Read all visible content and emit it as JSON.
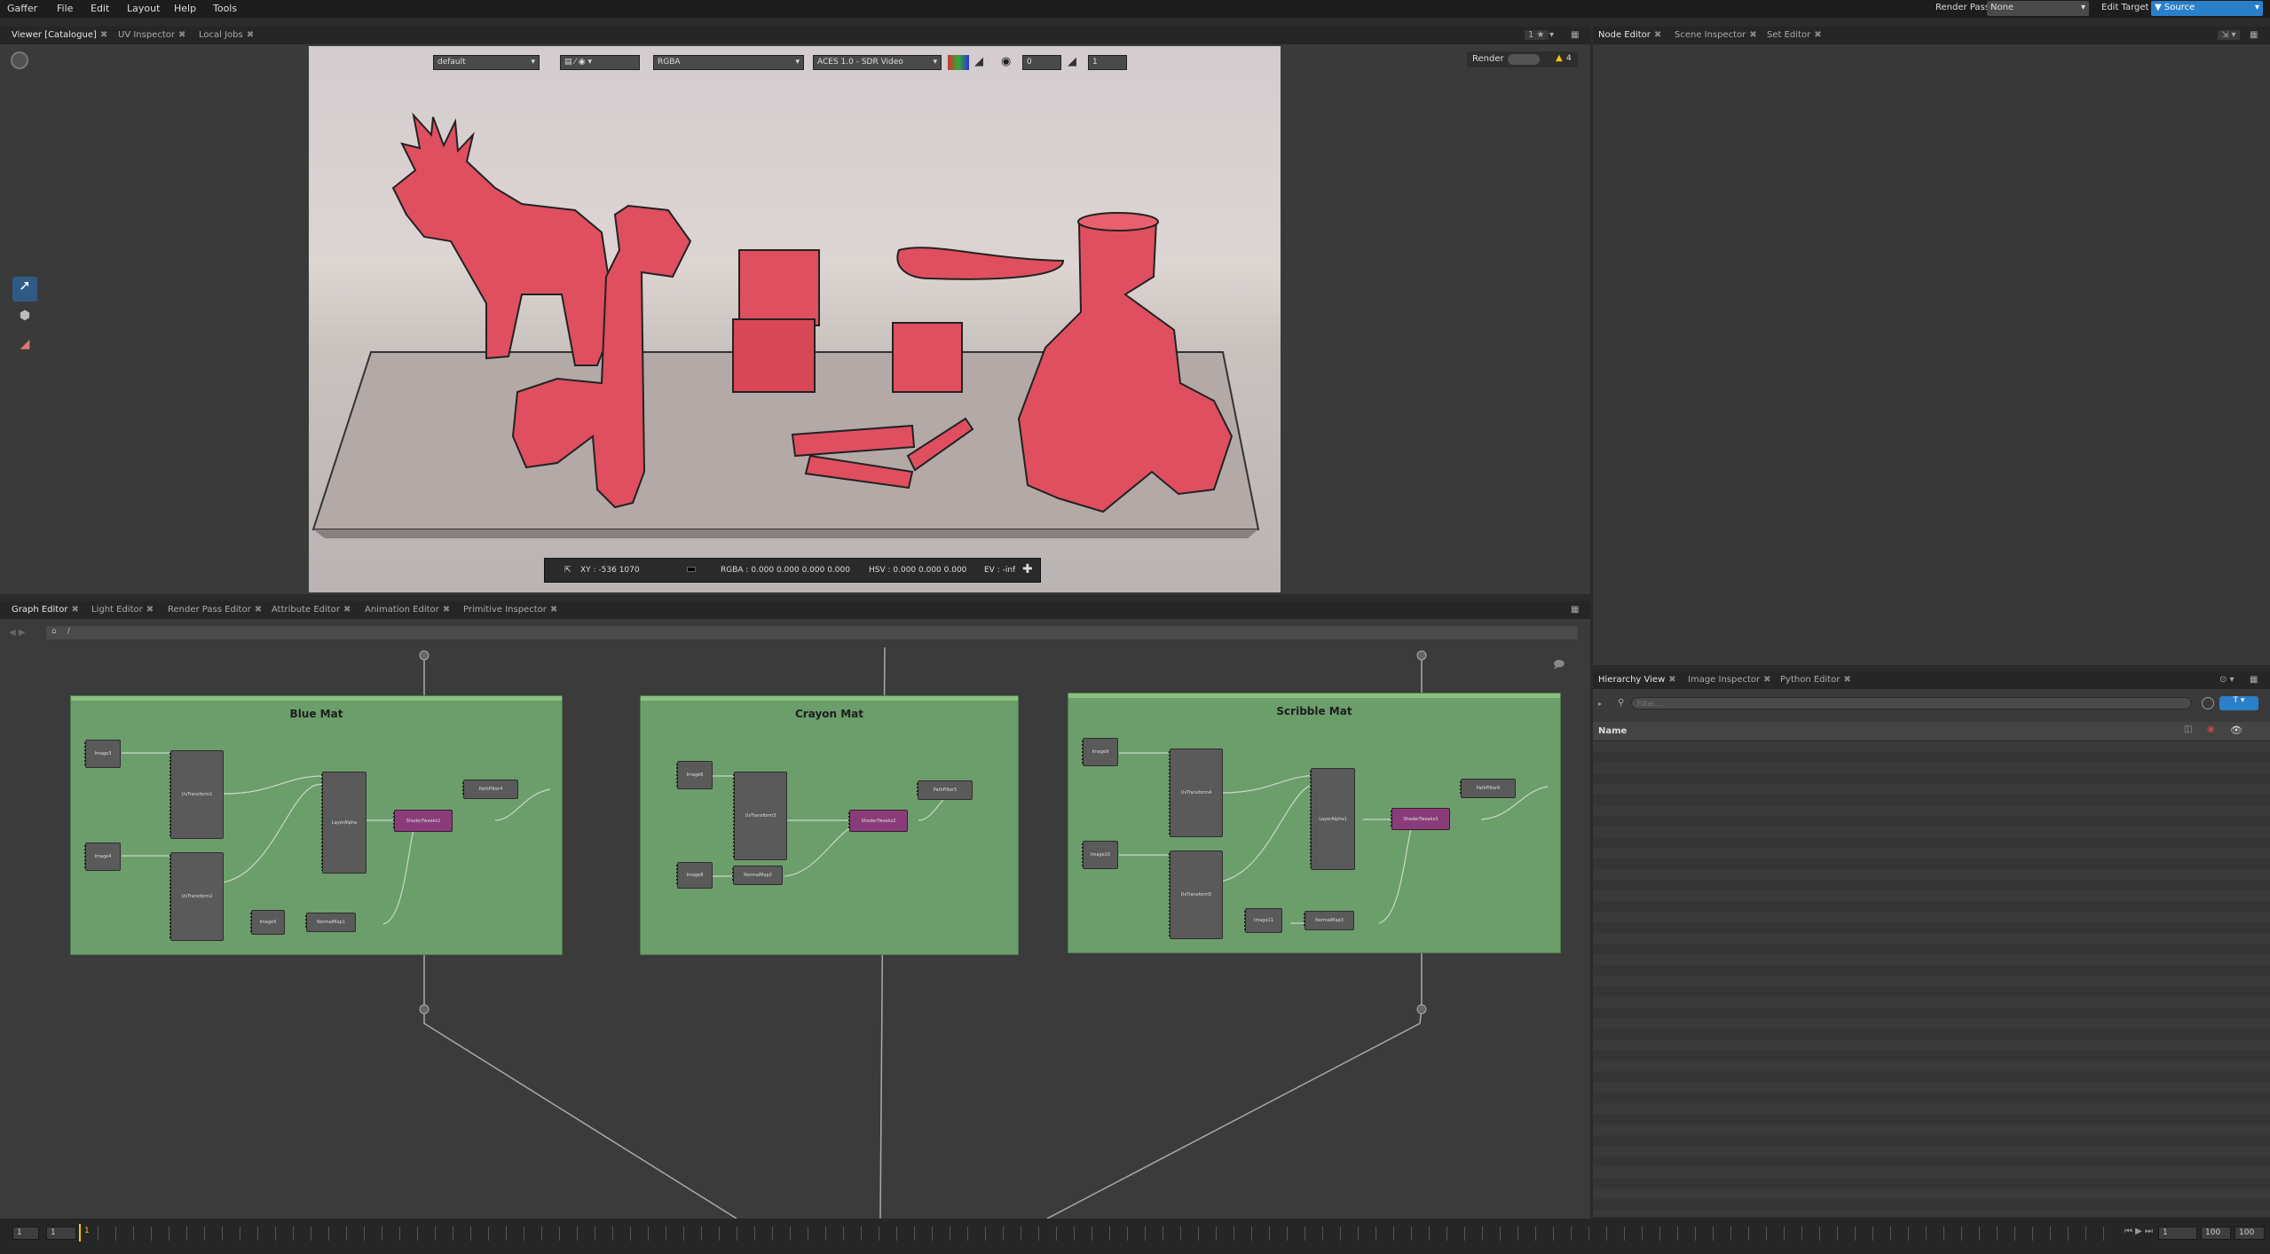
{
  "menubar": {
    "items": [
      "Gaffer",
      "File",
      "Edit",
      "Layout",
      "Help",
      "Tools"
    ],
    "render_pass_label": "Render Pass",
    "render_pass_value": "None",
    "edit_target_label": "Edit Target",
    "edit_target_value": "Source"
  },
  "viewer": {
    "tabs": [
      "Viewer [Catalogue]",
      "UV Inspector",
      "Local Jobs"
    ],
    "layout_menu": "1 ★",
    "display": "default",
    "channels": "RGBA",
    "color_space": "ACES 1.0 - SDR Video",
    "exposure": "0",
    "gamma": "1",
    "render_label": "Render",
    "warning_count": "4",
    "status": {
      "xy": "XY : -536  1070",
      "rgba": "RGBA : 0.000  0.000  0.000  0.000",
      "hsv": "HSV : 0.000  0.000  0.000",
      "ev": "EV : -inf"
    }
  },
  "graph": {
    "tabs": [
      "Graph Editor",
      "Light Editor",
      "Render Pass Editor",
      "Attribute Editor",
      "Animation Editor",
      "Primitive Inspector"
    ],
    "path": "/",
    "backdrops": [
      {
        "title": "Blue Mat",
        "nodes": [
          "Image3",
          "UvTransform1",
          "LayerAlpha",
          "ShaderTweaks1",
          "PathFilter4",
          "Image4",
          "UvTransform2",
          "Image5",
          "NormalMap1"
        ]
      },
      {
        "title": "Crayon Mat",
        "nodes": [
          "Image6",
          "UvTransform3",
          "ShaderTweaks2",
          "PathFilter5",
          "Image8",
          "NormalMap2"
        ]
      },
      {
        "title": "Scribble Mat",
        "nodes": [
          "Image9",
          "UvTransform4",
          "LayerAlpha1",
          "ShaderTweaks3",
          "PathFilter6",
          "Image10",
          "UvTransform5",
          "Image11",
          "NormalMap3"
        ]
      }
    ]
  },
  "node_editor": {
    "tabs": [
      "Node Editor",
      "Scene Inspector",
      "Set Editor"
    ]
  },
  "hierarchy": {
    "tabs": [
      "Hierarchy View",
      "Image Inspector",
      "Python Editor"
    ],
    "filter_placeholder": "Filter...",
    "column_name": "Name"
  },
  "timeline": {
    "start": "1",
    "current": "1",
    "frame_marker": "1",
    "frame": "1",
    "end": "100",
    "end2": "100"
  },
  "colors": {
    "backdrop": "#6c9e6b",
    "shader_node": "#8a3c7a",
    "accent": "#2a7fc9",
    "toy_red": "#e04f5f"
  }
}
